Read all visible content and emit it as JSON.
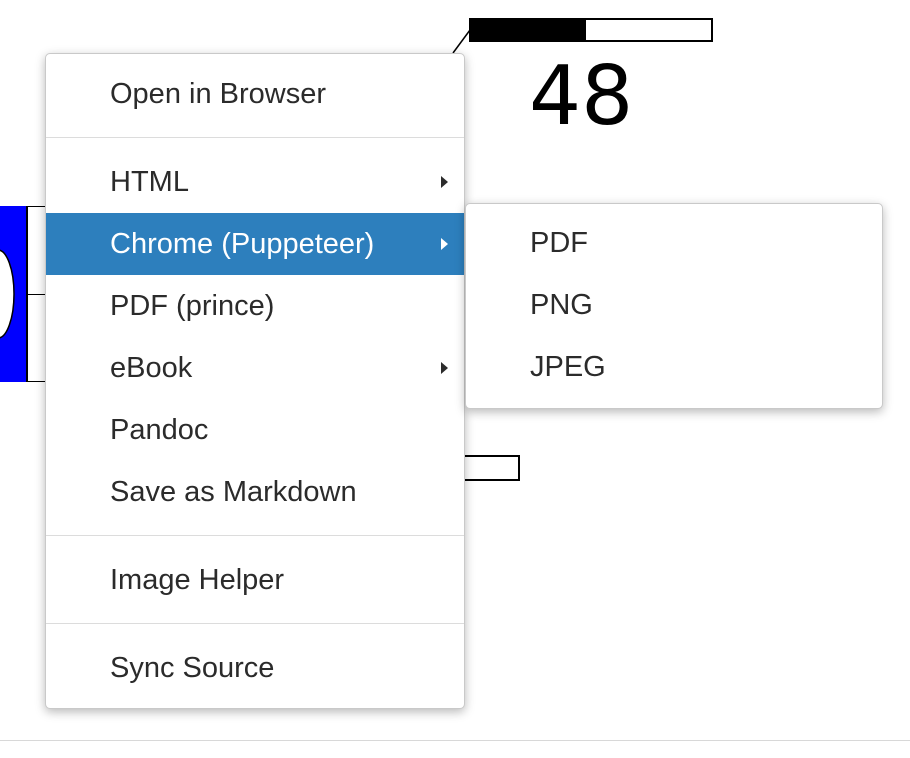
{
  "background": {
    "preview_number": "48",
    "progress_fraction": 0.48
  },
  "menu": {
    "items": [
      {
        "label": "Open in Browser"
      },
      {
        "label": "HTML",
        "submenu": true
      },
      {
        "label": "Chrome (Puppeteer)",
        "submenu": true,
        "active": true
      },
      {
        "label": "PDF (prince)"
      },
      {
        "label": "eBook",
        "submenu": true
      },
      {
        "label": "Pandoc"
      },
      {
        "label": "Save as Markdown"
      },
      {
        "label": "Image Helper"
      },
      {
        "label": "Sync Source"
      }
    ]
  },
  "submenu": {
    "items": [
      {
        "label": "PDF"
      },
      {
        "label": "PNG"
      },
      {
        "label": "JPEG"
      }
    ]
  },
  "colors": {
    "active_highlight": "#2d7fbd",
    "menu_text": "#2b2b2b",
    "preview_blue": "#0000ff"
  }
}
